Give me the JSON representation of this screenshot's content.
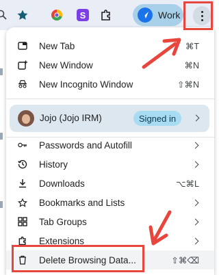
{
  "toolbar": {
    "profile_chip_label": "Work",
    "menu_button_label": "Customize and control Google Chrome"
  },
  "menu": {
    "sections": {
      "new": [
        {
          "label": "New Tab",
          "shortcut": "⌘T",
          "icon": "new-tab-icon"
        },
        {
          "label": "New Window",
          "shortcut": "⌘N",
          "icon": "new-window-icon"
        },
        {
          "label": "New Incognito Window",
          "shortcut": "⇧⌘N",
          "icon": "incognito-icon"
        }
      ],
      "profile": {
        "name": "Jojo (Jojo IRM)",
        "status": "Signed in"
      },
      "tools": [
        {
          "label": "Passwords and Autofill",
          "icon": "key-icon"
        },
        {
          "label": "History",
          "icon": "history-icon"
        },
        {
          "label": "Downloads",
          "shortcut": "⌥⌘L",
          "icon": "download-icon"
        },
        {
          "label": "Bookmarks and Lists",
          "icon": "star-icon"
        },
        {
          "label": "Tab Groups",
          "icon": "tab-groups-icon"
        },
        {
          "label": "Extensions",
          "icon": "extensions-icon"
        },
        {
          "label": "Delete Browsing Data...",
          "shortcut": "⇧⌘⌫",
          "icon": "trash-icon"
        }
      ]
    }
  },
  "colors": {
    "toolbar_bg": "#e9eef6",
    "highlight": "#e8463c",
    "profile_row_bg": "#dce7ef",
    "signed_in_badge": "#a8dcf2",
    "work_chip": "#a8d0e9"
  }
}
